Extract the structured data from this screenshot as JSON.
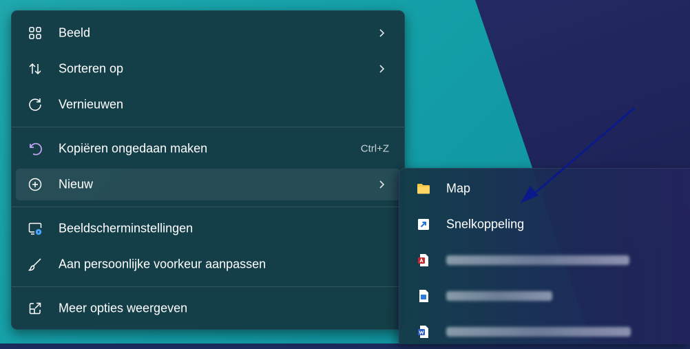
{
  "menu": {
    "items": [
      {
        "label": "Beeld",
        "icon": "view-grid-icon"
      },
      {
        "label": "Sorteren op",
        "icon": "sort-arrows-icon"
      },
      {
        "label": "Vernieuwen",
        "icon": "refresh-icon"
      },
      {
        "label": "Kopiëren ongedaan maken",
        "shortcut": "Ctrl+Z",
        "icon": "undo-icon"
      },
      {
        "label": "Nieuw",
        "icon": "add-circle-icon"
      },
      {
        "label": "Beeldscherminstellingen",
        "icon": "display-settings-icon"
      },
      {
        "label": "Aan persoonlijke voorkeur aanpassen",
        "icon": "brush-icon"
      },
      {
        "label": "Meer opties weergeven",
        "icon": "expand-icon"
      }
    ]
  },
  "submenu": {
    "items": [
      {
        "label": "Map",
        "icon": "folder-icon"
      },
      {
        "label": "Snelkoppeling",
        "icon": "shortcut-icon"
      }
    ]
  },
  "colors": {
    "menu_bg": "#153a44",
    "desktop_teal": "#14a0a8",
    "desktop_navy": "#1f255a",
    "annotation_arrow": "#0b1a8a"
  }
}
